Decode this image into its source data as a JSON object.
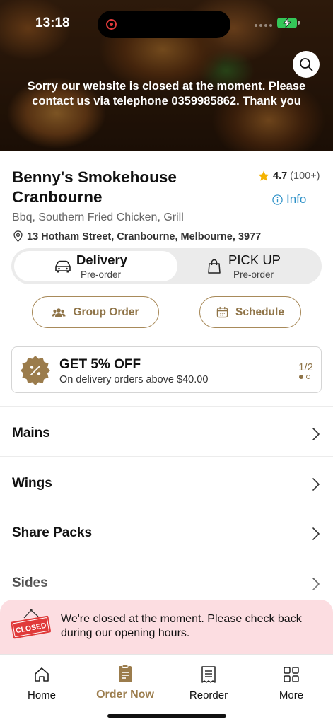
{
  "status_bar": {
    "time": "13:18"
  },
  "hero": {
    "closed_message": "Sorry our website is closed at the moment. Please contact us via telephone 0359985862. Thank you",
    "search_icon": "search-icon"
  },
  "store": {
    "name": "Benny's Smokehouse Cranbourne",
    "rating": "4.7",
    "rating_count": "(100+)",
    "info_label": "Info",
    "cuisines": "Bbq, Southern Fried Chicken, Grill",
    "address": "13 Hotham Street, Cranbourne, Melbourne, 3977"
  },
  "order_mode": {
    "options": [
      {
        "label": "Delivery",
        "sublabel": "Pre-order",
        "icon": "car-icon",
        "selected": true
      },
      {
        "label": "PICK UP",
        "sublabel": "Pre-order",
        "icon": "shopping-bag-icon",
        "selected": false
      }
    ]
  },
  "actions": {
    "group_order_label": "Group Order",
    "schedule_label": "Schedule"
  },
  "promo": {
    "title": "GET 5% OFF",
    "subtitle": "On delivery orders above $40.00",
    "page_indicator": "1/2",
    "current_page": 1,
    "total_pages": 2
  },
  "menu": {
    "categories": [
      "Mains",
      "Wings",
      "Share Packs",
      "Sides"
    ]
  },
  "closed_banner": {
    "sign_text": "CLOSED",
    "message": "We're closed at the moment. Please check back during our opening hours."
  },
  "tab_bar": {
    "tabs": [
      {
        "label": "Home",
        "icon": "home-icon",
        "active": false
      },
      {
        "label": "Order Now",
        "icon": "order-icon",
        "active": true
      },
      {
        "label": "Reorder",
        "icon": "receipt-icon",
        "active": false
      },
      {
        "label": "More",
        "icon": "grid-icon",
        "active": false
      }
    ]
  },
  "colors": {
    "accent_gold": "#9b7c4c",
    "info_blue": "#2a8fc7",
    "closed_banner_bg": "#fcdde1",
    "closed_sign_red": "#e03a3a",
    "rating_star": "#f5b301"
  }
}
